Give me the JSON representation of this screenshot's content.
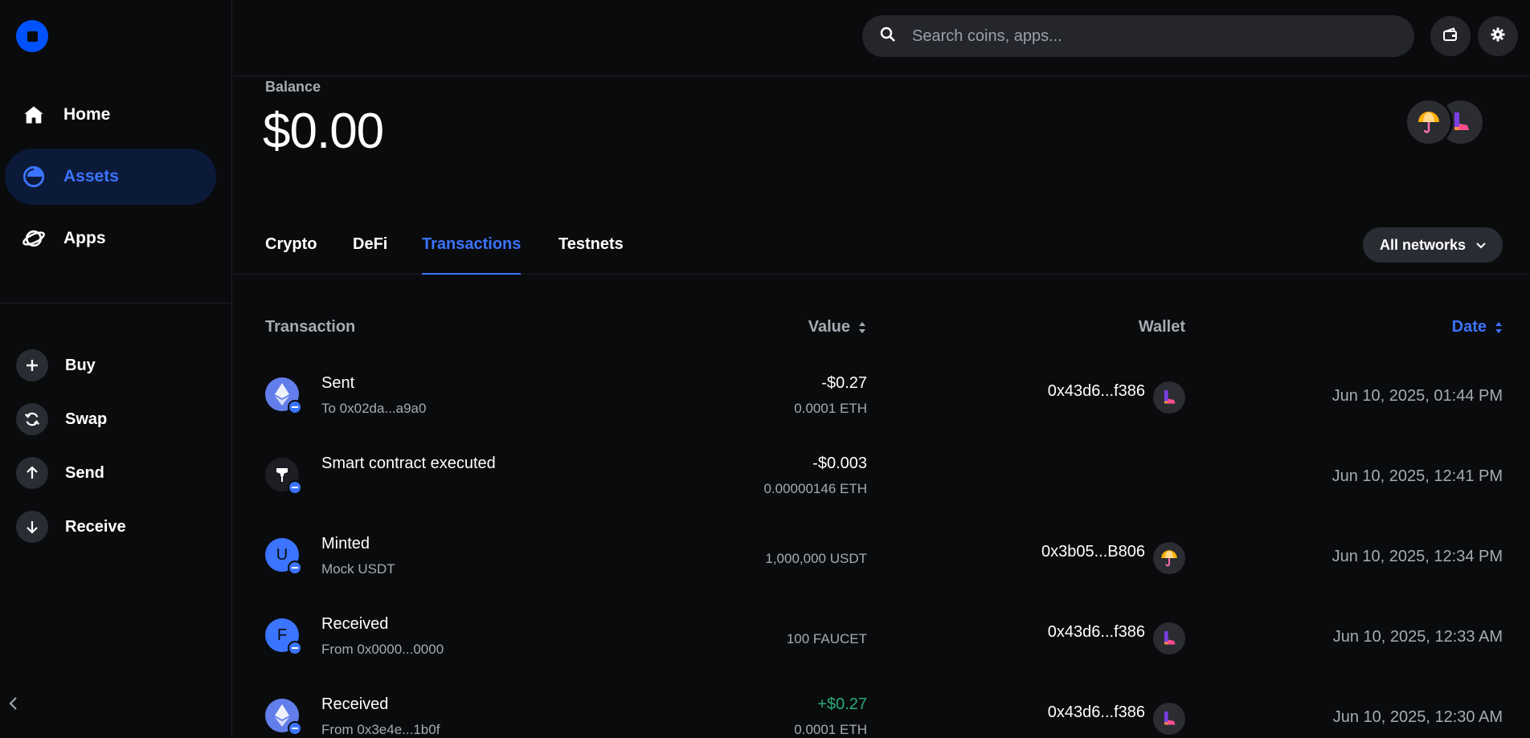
{
  "nav": {
    "items": [
      {
        "label": "Home",
        "icon": "home-icon"
      },
      {
        "label": "Assets",
        "icon": "pie-chart-icon",
        "active": true
      },
      {
        "label": "Apps",
        "icon": "planet-icon"
      }
    ],
    "actions": [
      {
        "label": "Buy",
        "icon": "plus-icon"
      },
      {
        "label": "Swap",
        "icon": "swap-icon"
      },
      {
        "label": "Send",
        "icon": "arrow-up-icon"
      },
      {
        "label": "Receive",
        "icon": "arrow-down-icon"
      }
    ]
  },
  "header": {
    "search_placeholder": "Search coins, apps..."
  },
  "balance": {
    "label": "Balance",
    "value": "$0.00"
  },
  "tabs": [
    {
      "label": "Crypto"
    },
    {
      "label": "DeFi"
    },
    {
      "label": "Transactions",
      "active": true
    },
    {
      "label": "Testnets"
    }
  ],
  "network_filter": "All networks",
  "table": {
    "headers": {
      "transaction": "Transaction",
      "value": "Value",
      "wallet": "Wallet",
      "date": "Date"
    },
    "rows": [
      {
        "title": "Sent",
        "subtitle": "To 0x02da...a9a0",
        "value": "-$0.27",
        "amount": "0.0001 ETH",
        "wallet": "0x43d6...f386",
        "date": "Jun 10, 2025, 01:44 PM",
        "icon": "eth-icon"
      },
      {
        "title": "Smart contract executed",
        "subtitle": "",
        "value": "-$0.003",
        "amount": "0.00000146 ETH",
        "wallet": "",
        "date": "Jun 10, 2025, 12:41 PM",
        "icon": "contract-icon"
      },
      {
        "title": "Minted",
        "subtitle": "Mock USDT",
        "value": "",
        "amount": "1,000,000 USDT",
        "wallet": "0x3b05...B806",
        "date": "Jun 10, 2025, 12:34 PM",
        "icon": "token-u-icon",
        "letter": "U"
      },
      {
        "title": "Received",
        "subtitle": "From 0x0000...0000",
        "value": "",
        "amount": "100 FAUCET",
        "wallet": "0x43d6...f386",
        "date": "Jun 10, 2025, 12:33 AM",
        "icon": "token-f-icon",
        "letter": "F"
      },
      {
        "title": "Received",
        "subtitle": "From 0x3e4e...1b0f",
        "value": "+$0.27",
        "amount": "0.0001 ETH",
        "wallet": "0x43d6...f386",
        "date": "Jun 10, 2025, 12:30 AM",
        "icon": "eth-icon"
      }
    ]
  },
  "colors": {
    "accent": "#3b74ff",
    "positive": "#27ad75",
    "background": "#0a0b0d",
    "muted": "#a6abb3"
  }
}
